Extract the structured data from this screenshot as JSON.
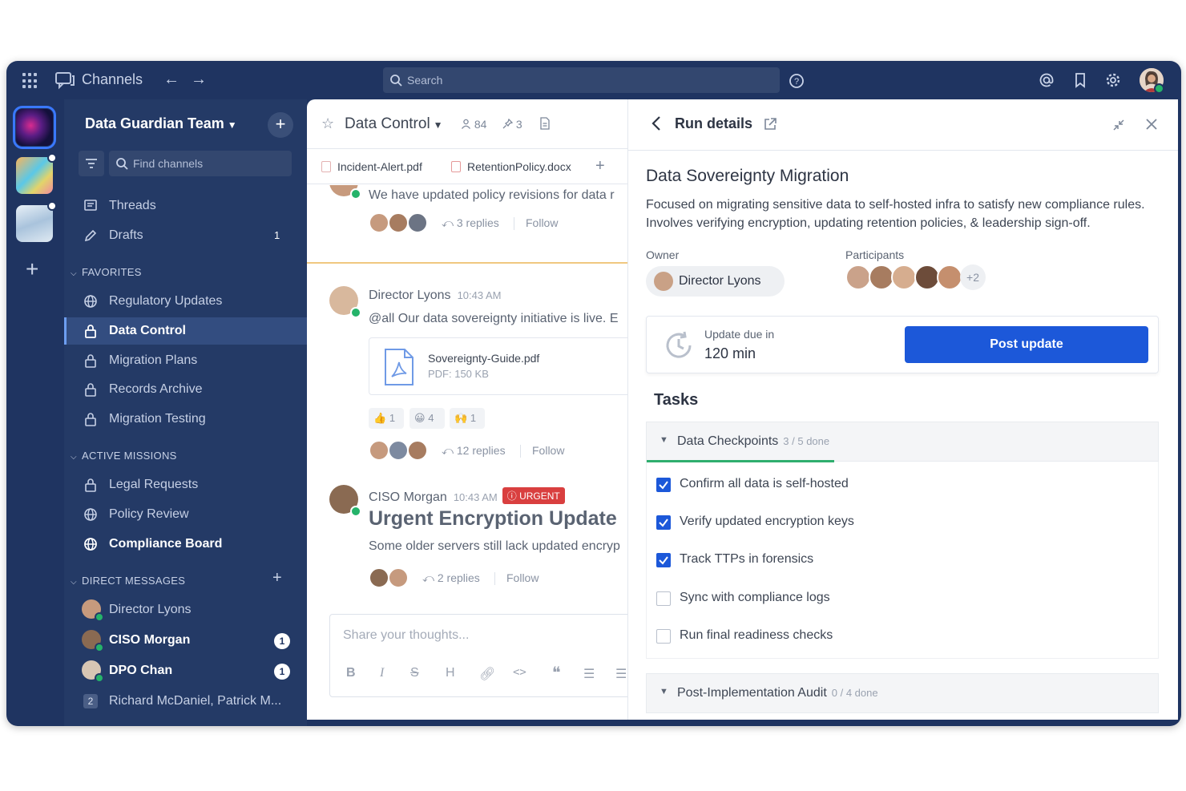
{
  "topbar": {
    "title": "Channels",
    "search_placeholder": "Search"
  },
  "sidebar": {
    "team_name": "Data Guardian Team",
    "find_placeholder": "Find channels",
    "items": [
      {
        "label": "Threads"
      },
      {
        "label": "Drafts",
        "count": "1"
      }
    ],
    "favorites_title": "FAVORITES",
    "favorites": [
      {
        "label": "Regulatory Updates"
      },
      {
        "label": "Data Control"
      },
      {
        "label": "Migration Plans"
      },
      {
        "label": "Records Archive"
      },
      {
        "label": "Migration Testing"
      }
    ],
    "missions_title": "ACTIVE MISSIONS",
    "missions": [
      {
        "label": "Legal Requests"
      },
      {
        "label": "Policy Review"
      },
      {
        "label": "Compliance Board"
      }
    ],
    "dm_title": "DIRECT MESSAGES",
    "dms": [
      {
        "label": "Director Lyons"
      },
      {
        "label": "CISO Morgan",
        "badge": "1"
      },
      {
        "label": "DPO Chan",
        "badge": "1"
      },
      {
        "label": "Richard McDaniel, Patrick M...",
        "group_count": "2"
      }
    ]
  },
  "channel": {
    "name": "Data Control",
    "members": "84",
    "pins": "3",
    "files": [
      "Incident-Alert.pdf",
      "RetentionPolicy.docx"
    ],
    "messages": {
      "first_text": "We have updated policy revisions for data r",
      "first_replies": "3 replies",
      "follow": "Follow",
      "lyons_author": "Director Lyons",
      "lyons_time": "10:43 AM",
      "lyons_text": "@all Our data sovereignty initiative is live. E",
      "attachment_name": "Sovereignty-Guide.pdf",
      "attachment_size": "PDF: 150 KB",
      "reactions": [
        {
          "emoji": "👍",
          "count": "1"
        },
        {
          "emoji": "😀",
          "count": "4"
        },
        {
          "emoji": "🙌",
          "count": "1"
        }
      ],
      "lyons_replies": "12 replies",
      "morgan_author": "CISO Morgan",
      "morgan_time": "10:43 AM",
      "urgent_label": "URGENT",
      "morgan_title": "Urgent Encryption Update",
      "morgan_text": "Some older servers still lack updated encryp",
      "morgan_replies": "2 replies"
    },
    "composer_placeholder": "Share your thoughts..."
  },
  "panel": {
    "title": "Run details",
    "mission_title": "Data Sovereignty Migration",
    "description": "Focused on migrating sensitive data to self-hosted infra to satisfy new compliance rules. Involves verifying encryption, updating retention policies, & leadership sign-off.",
    "owner_label": "Owner",
    "owner_name": "Director Lyons",
    "participants_label": "Participants",
    "participants_more": "+2",
    "due_label": "Update due in",
    "due_value": "120 min",
    "post_button": "Post update",
    "tasks_title": "Tasks",
    "groups": [
      {
        "name": "Data Checkpoints",
        "progress": "3 / 5 done",
        "done_fraction": 0.6
      },
      {
        "name": "Post-Implementation Audit",
        "progress": "0 / 4 done",
        "done_fraction": 0
      }
    ],
    "tasks": [
      {
        "label": "Confirm all data is self-hosted",
        "checked": true
      },
      {
        "label": "Verify updated encryption keys",
        "checked": true
      },
      {
        "label": "Track TTPs in forensics",
        "checked": true
      },
      {
        "label": "Sync with compliance logs",
        "checked": false
      },
      {
        "label": "Run final readiness checks",
        "checked": false
      }
    ]
  },
  "colors": {
    "accent": "#1c58d9",
    "sidebar_bg": "#243a66",
    "urgent": "#d93f3f",
    "progress": "#2fae6e"
  }
}
